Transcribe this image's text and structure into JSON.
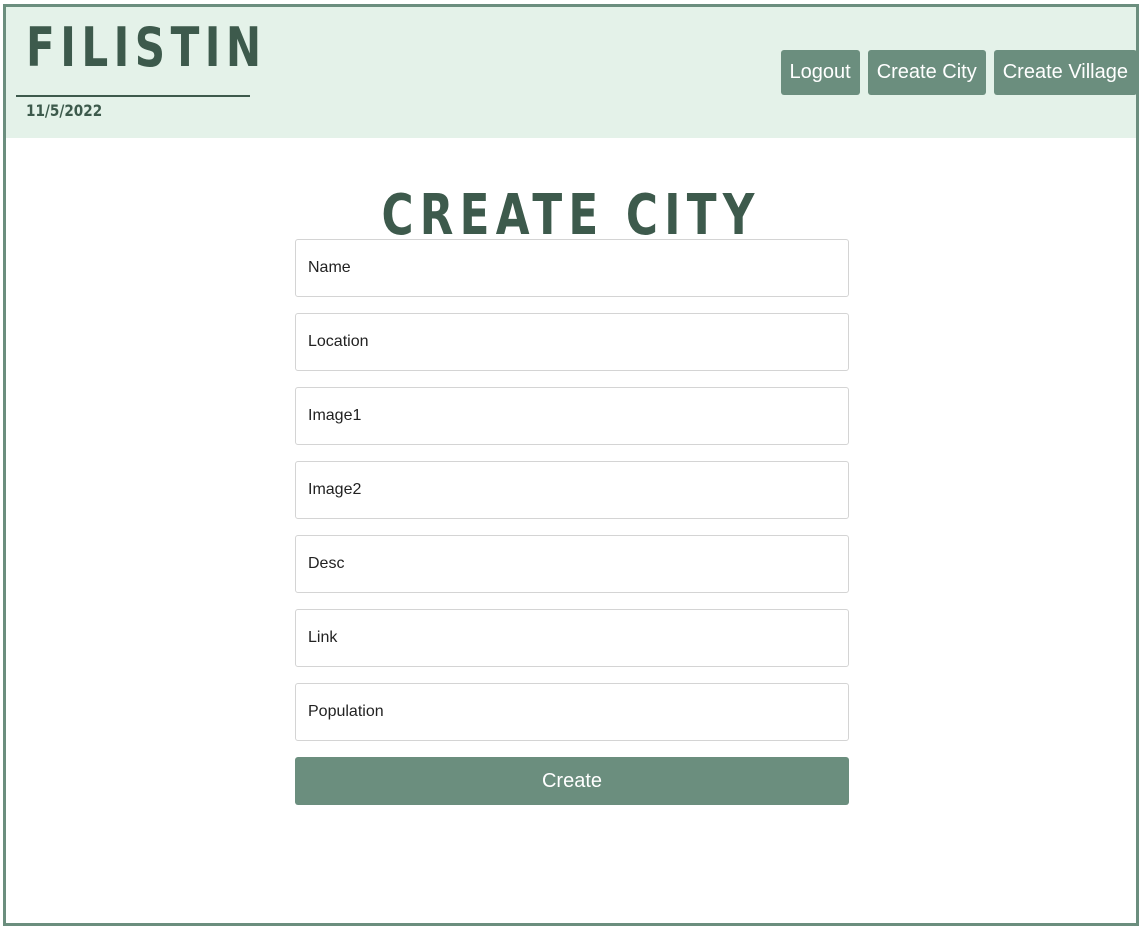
{
  "header": {
    "brand": "FILISTIN",
    "date": "11/5/2022",
    "nav": [
      {
        "label": "Logout"
      },
      {
        "label": "Create City"
      },
      {
        "label": "Create Village"
      }
    ]
  },
  "page": {
    "title": "CREATE CITY"
  },
  "form": {
    "fields": [
      {
        "placeholder": "Name",
        "value": ""
      },
      {
        "placeholder": "Location",
        "value": ""
      },
      {
        "placeholder": "Image1",
        "value": ""
      },
      {
        "placeholder": "Image2",
        "value": ""
      },
      {
        "placeholder": "Desc",
        "value": ""
      },
      {
        "placeholder": "Link",
        "value": ""
      },
      {
        "placeholder": "Population",
        "value": ""
      }
    ],
    "submit_label": "Create"
  },
  "colors": {
    "accent": "#6b8e7e",
    "brand_dark": "#3d5a4c",
    "header_bg": "#e4f2e9"
  }
}
